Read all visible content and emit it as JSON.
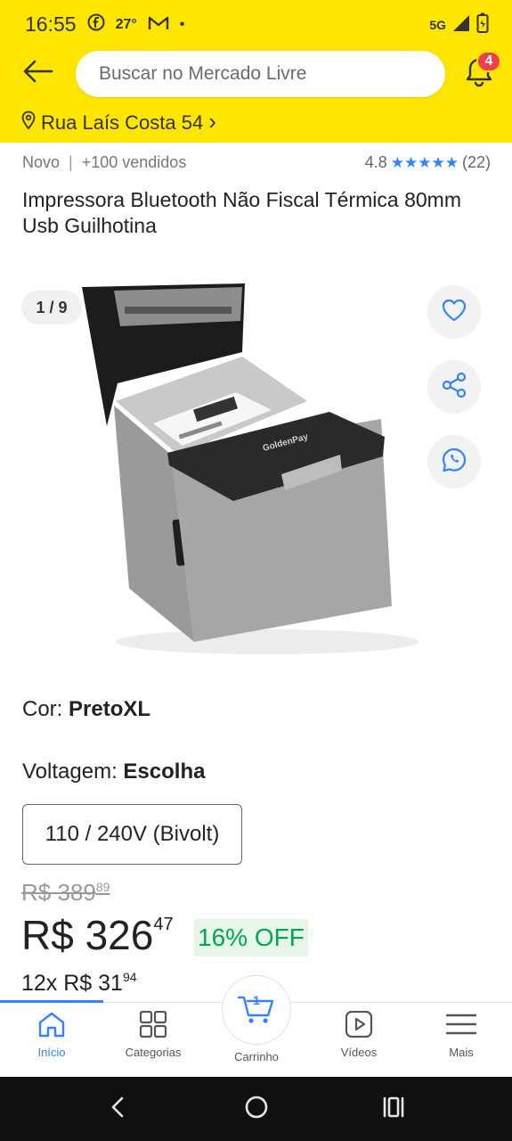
{
  "status_bar": {
    "time": "16:55",
    "temperature": "27°",
    "network": "5G",
    "dot": "•"
  },
  "header": {
    "search_placeholder": "Buscar no Mercado Livre",
    "notification_count": "4",
    "address": "Rua Laís Costa 54",
    "address_chevron": "›"
  },
  "product": {
    "condition": "Novo",
    "separator": "|",
    "sold": "+100 vendidos",
    "rating": "4.8",
    "stars": "★★★★★",
    "review_count": "(22)",
    "title": "Impressora Bluetooth Não Fiscal Térmica 80mm Usb Guilhotina",
    "image_counter": "1 / 9",
    "printer_brand": "GoldenPay"
  },
  "variations": {
    "color_label": "Cor: ",
    "color_value": "PretoXL",
    "voltage_label": "Voltagem: ",
    "voltage_value": "Escolha",
    "voltage_option": "110 / 240V (Bivolt)"
  },
  "pricing": {
    "old_price_main": "R$ 389",
    "old_price_cents": "89",
    "price_main": "R$ 326",
    "price_cents": "47",
    "discount": "16% OFF",
    "installments_main": "12x R$ 31",
    "installments_cents": "94"
  },
  "bottom_nav": {
    "items": [
      {
        "label": "Início",
        "icon": "home-icon"
      },
      {
        "label": "Categorias",
        "icon": "grid-icon"
      },
      {
        "label": "Carrinho",
        "icon": "cart-icon"
      },
      {
        "label": "Vídeos",
        "icon": "video-icon"
      },
      {
        "label": "Mais",
        "icon": "menu-icon"
      }
    ],
    "cart_count": "1"
  },
  "colors": {
    "brand_yellow": "#ffe600",
    "accent_blue": "#3483fa",
    "discount_green": "#00a650",
    "badge_red": "#f23d4f"
  }
}
